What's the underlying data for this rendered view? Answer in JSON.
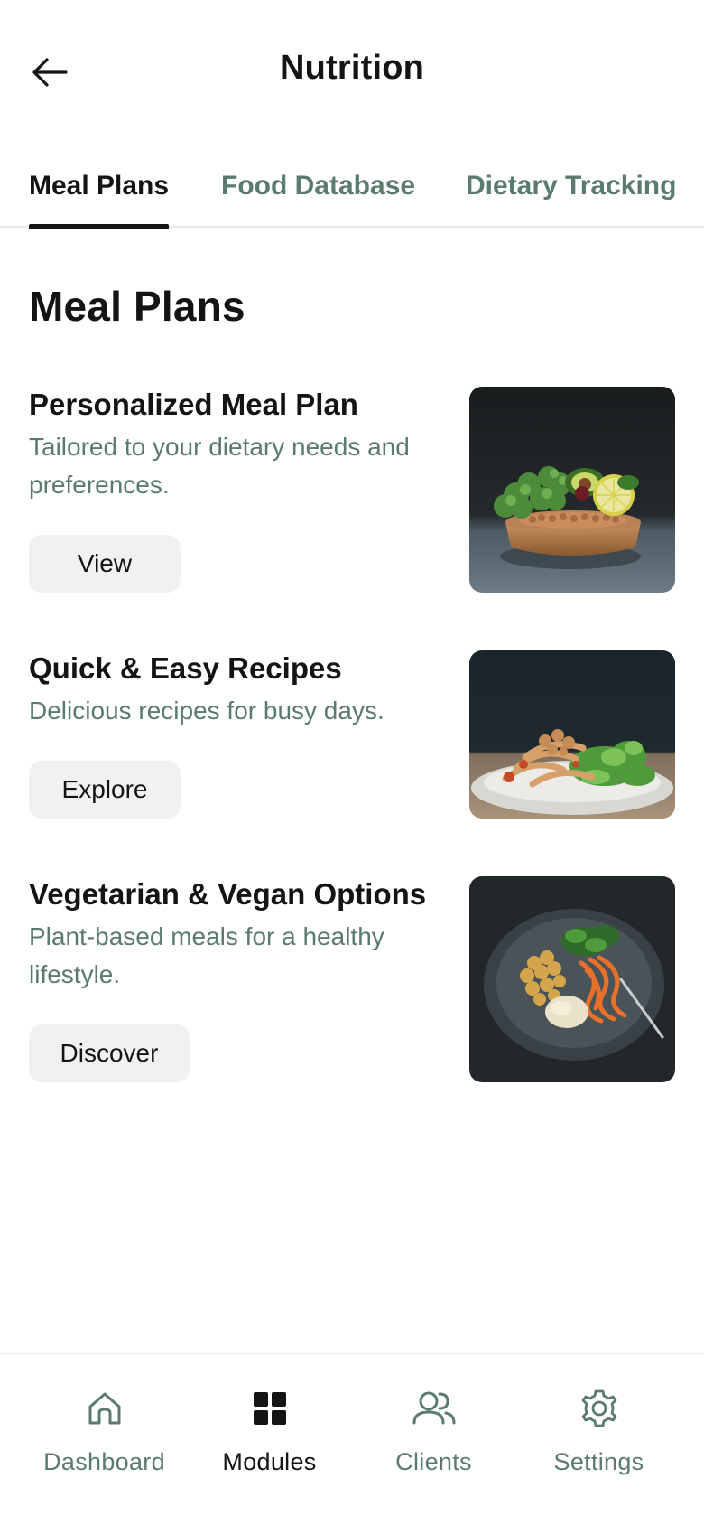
{
  "header": {
    "title": "Nutrition",
    "back_icon": "arrow-left-icon"
  },
  "tabs": [
    {
      "label": "Meal Plans",
      "active": true
    },
    {
      "label": "Food Database",
      "active": false
    },
    {
      "label": "Dietary Tracking",
      "active": false
    }
  ],
  "section": {
    "title": "Meal Plans",
    "cards": [
      {
        "title": "Personalized Meal Plan",
        "description": "Tailored to your dietary needs and preferences.",
        "button": "View",
        "image": "bowl-broccoli-avocado-lentils-photo"
      },
      {
        "title": "Quick & Easy Recipes",
        "description": "Delicious recipes for busy days.",
        "button": "Explore",
        "image": "pasta-greens-plate-photo"
      },
      {
        "title": "Vegetarian & Vegan Options",
        "description": "Plant-based meals for a healthy lifestyle.",
        "button": "Discover",
        "image": "chickpea-carrot-greens-plate-photo"
      }
    ]
  },
  "bottom_nav": [
    {
      "label": "Dashboard",
      "icon": "home-icon",
      "active": false
    },
    {
      "label": "Modules",
      "icon": "grid-icon",
      "active": true
    },
    {
      "label": "Clients",
      "icon": "users-icon",
      "active": false
    },
    {
      "label": "Settings",
      "icon": "gear-icon",
      "active": false
    }
  ],
  "colors": {
    "text_primary": "#141414",
    "text_secondary": "#5b7b6c",
    "button_bg": "#eff2f1",
    "divider": "#e5e8e7"
  }
}
